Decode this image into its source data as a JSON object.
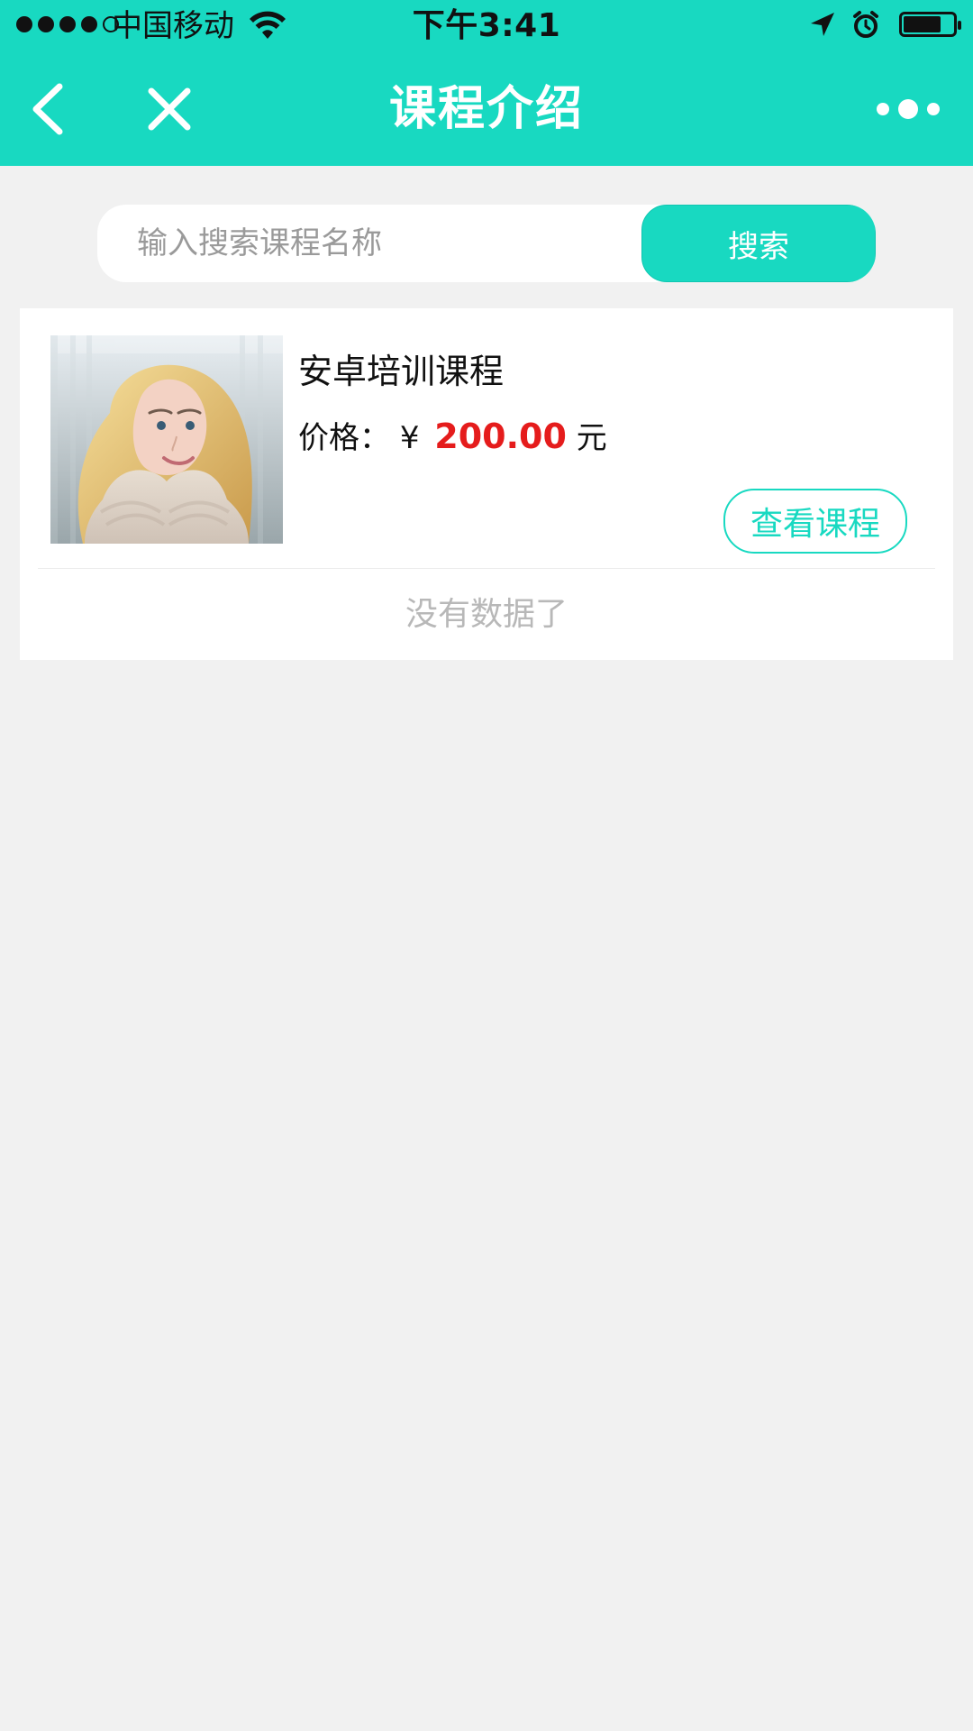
{
  "status_bar": {
    "carrier": "中国移动",
    "time": "下午3:41"
  },
  "nav": {
    "title": "课程介绍"
  },
  "search": {
    "placeholder": "输入搜索课程名称",
    "button_label": "搜索"
  },
  "courses": [
    {
      "title": "安卓培训课程",
      "price_label": "价格：",
      "currency": "¥",
      "price": "200.00",
      "unit": "元",
      "action_label": "查看课程"
    }
  ],
  "list_footer": {
    "text": "没有数据了"
  },
  "colors": {
    "accent": "#18d9c1",
    "price": "#e51c1c",
    "background": "#f1f1f1"
  }
}
